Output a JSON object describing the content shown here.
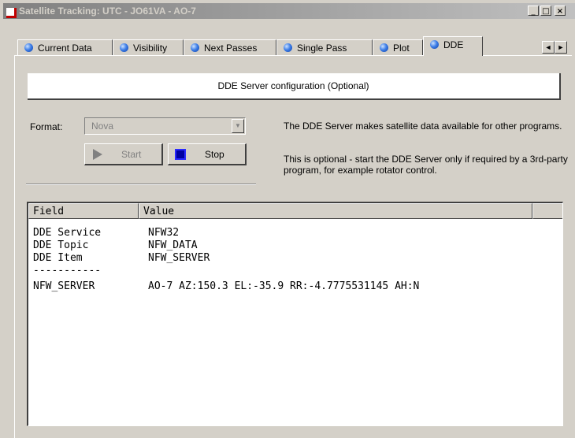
{
  "window": {
    "title": "Satellite Tracking: UTC - JO61VA - AO-7",
    "minimize_glyph": "_",
    "maximize_glyph": "□",
    "close_glyph": "×"
  },
  "tabs": [
    {
      "label": "Current Data",
      "icon": "globe-icon"
    },
    {
      "label": "Visibility",
      "icon": "globe-icon"
    },
    {
      "label": "Next Passes",
      "icon": "globe-icon"
    },
    {
      "label": "Single Pass",
      "icon": "globe-icon"
    },
    {
      "label": "Plot",
      "icon": "globe-icon"
    },
    {
      "label": "DDE",
      "icon": "globe-icon",
      "active": true
    }
  ],
  "tab_scroll": {
    "left": "◄",
    "right": "►"
  },
  "dde": {
    "header": "DDE Server configuration (Optional)",
    "format_label": "Format:",
    "format_value": "Nova",
    "dropdown_glyph": "▼",
    "start_label": "Start",
    "stop_label": "Stop",
    "description_1": "The DDE Server makes satellite data available for other programs.",
    "description_2": "This is optional - start the DDE Server only if required by a 3rd-party program, for example rotator control."
  },
  "list": {
    "columns": [
      "Field",
      "Value"
    ],
    "rows": [
      {
        "field": "DDE Service",
        "value": "NFW32"
      },
      {
        "field": "DDE Topic",
        "value": "NFW_DATA"
      },
      {
        "field": "DDE Item",
        "value": "NFW_SERVER"
      },
      {
        "field": "-----------",
        "value": ""
      },
      {
        "field": "NFW_SERVER",
        "value": "AO-7 AZ:150.3 EL:-35.9 RR:-4.7775531145 AH:N"
      }
    ]
  },
  "colors": {
    "face": "#d4d0c8",
    "title_gradient_start": "#808080",
    "stop_icon": "#0000a0",
    "globe": "#3f7fe8"
  }
}
